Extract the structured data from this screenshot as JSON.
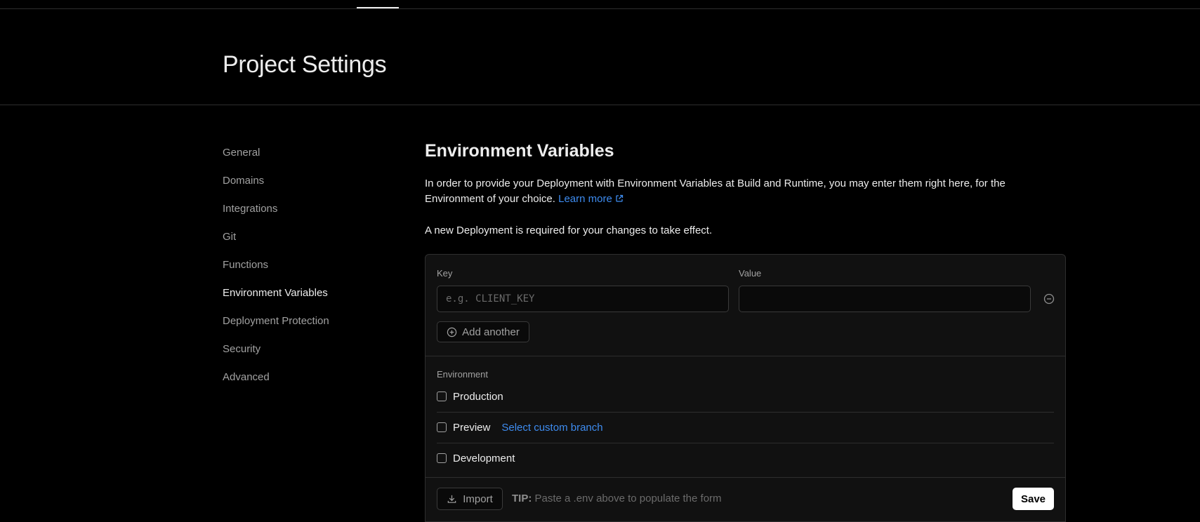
{
  "header": {
    "title": "Project Settings"
  },
  "sidebar": {
    "items": [
      {
        "label": "General"
      },
      {
        "label": "Domains"
      },
      {
        "label": "Integrations"
      },
      {
        "label": "Git"
      },
      {
        "label": "Functions"
      },
      {
        "label": "Environment Variables",
        "active": true
      },
      {
        "label": "Deployment Protection"
      },
      {
        "label": "Security"
      },
      {
        "label": "Advanced"
      }
    ]
  },
  "main": {
    "title": "Environment Variables",
    "description": "In order to provide your Deployment with Environment Variables at Build and Runtime, you may enter them right here, for the Environment of your choice.",
    "learn_more": "Learn more",
    "note": "A new Deployment is required for your changes to take effect."
  },
  "form": {
    "key_label": "Key",
    "key_placeholder": "e.g. CLIENT_KEY",
    "key_value": "",
    "value_label": "Value",
    "value_value": "",
    "add_another": "Add another",
    "environment_label": "Environment",
    "environments": [
      {
        "label": "Production",
        "checked": false
      },
      {
        "label": "Preview",
        "checked": false,
        "link": "Select custom branch"
      },
      {
        "label": "Development",
        "checked": false
      }
    ],
    "import_label": "Import",
    "tip_prefix": "TIP:",
    "tip_text": "Paste a .env above to populate the form",
    "save_label": "Save"
  },
  "colors": {
    "background": "#000000",
    "panel": "#111111",
    "accent_link": "#3e8cf0",
    "text": "#ededed",
    "muted": "#a1a1a1"
  }
}
